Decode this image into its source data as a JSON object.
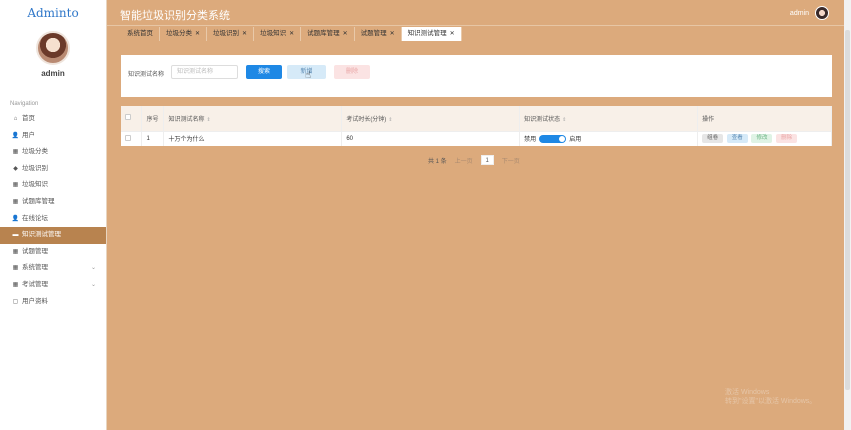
{
  "brand": "Adminto",
  "user": {
    "name": "admin"
  },
  "nav_title": "Navigation",
  "nav_items": [
    {
      "label": "首页",
      "icon": "home-icon"
    },
    {
      "label": "用户",
      "icon": "user-icon"
    },
    {
      "label": "垃圾分类",
      "icon": "grid-icon"
    },
    {
      "label": "垃圾识别",
      "icon": "tag-icon"
    },
    {
      "label": "垃圾知识",
      "icon": "grid-icon"
    },
    {
      "label": "试题库管理",
      "icon": "grid-icon"
    },
    {
      "label": "在线论坛",
      "icon": "user-icon"
    },
    {
      "label": "知识测试管理",
      "icon": "briefcase-icon",
      "active": true
    },
    {
      "label": "试题管理",
      "icon": "grid-icon"
    },
    {
      "label": "系统管理",
      "icon": "grid-icon",
      "expandable": true
    },
    {
      "label": "考试管理",
      "icon": "grid-icon",
      "expandable": true
    },
    {
      "label": "用户资料",
      "icon": "document-icon"
    }
  ],
  "header": {
    "title": "智能垃圾识别分类系统",
    "admin_label": "admin"
  },
  "tabs": [
    {
      "label": "系统首页",
      "closable": false
    },
    {
      "label": "垃圾分类",
      "closable": true
    },
    {
      "label": "垃圾识别",
      "closable": true
    },
    {
      "label": "垃圾知识",
      "closable": true
    },
    {
      "label": "试题库管理",
      "closable": true
    },
    {
      "label": "试题管理",
      "closable": true
    },
    {
      "label": "知识测试管理",
      "closable": true,
      "active": true
    }
  ],
  "search": {
    "label": "知识测试名称",
    "placeholder": "知识测试名称",
    "search_btn": "搜索",
    "add_btn": "新增",
    "delete_btn": "删除"
  },
  "table": {
    "columns": [
      "序号",
      "知识测试名称",
      "考试时长(分钟)",
      "知识测试状态",
      "操作"
    ],
    "rows": [
      {
        "index": "1",
        "name": "十万个为什么",
        "duration": "60",
        "status_off": "禁用",
        "status_on": "启用",
        "enabled": true
      }
    ],
    "actions": [
      "组卷",
      "查看",
      "修改",
      "删除"
    ]
  },
  "pager": {
    "total": "共 1 条",
    "prev": "上一页",
    "page": "1",
    "next": "下一页"
  },
  "watermark": [
    "激活 Windows",
    "转到\"设置\"以激活 Windows。"
  ],
  "colors": {
    "header_bg": "#dcaa7c",
    "active_nav": "#b8834f",
    "primary": "#1e88e5"
  }
}
